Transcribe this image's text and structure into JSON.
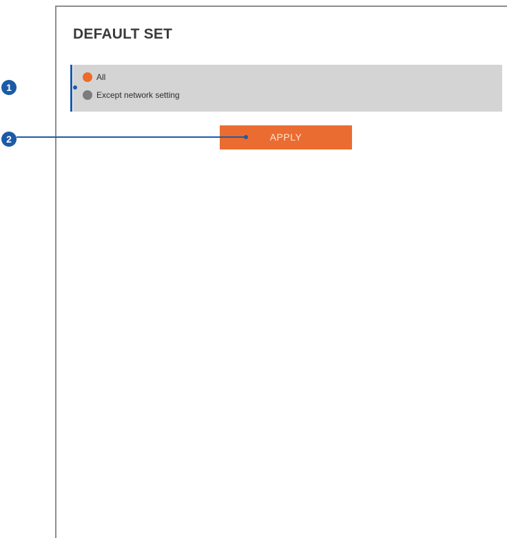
{
  "page": {
    "title": "DEFAULT SET"
  },
  "options": [
    {
      "label": "All",
      "selected": true
    },
    {
      "label": "Except network setting",
      "selected": false
    }
  ],
  "apply_button": {
    "label": "APPLY"
  },
  "callouts": [
    {
      "number": "1"
    },
    {
      "number": "2"
    }
  ],
  "colors": {
    "accent": "#ea6c30",
    "selected_radio": "#ec6a2c",
    "unselected_radio": "#7c7c7c",
    "panel_background": "#d4d4d4",
    "callout_blue": "#1c5aa6"
  }
}
